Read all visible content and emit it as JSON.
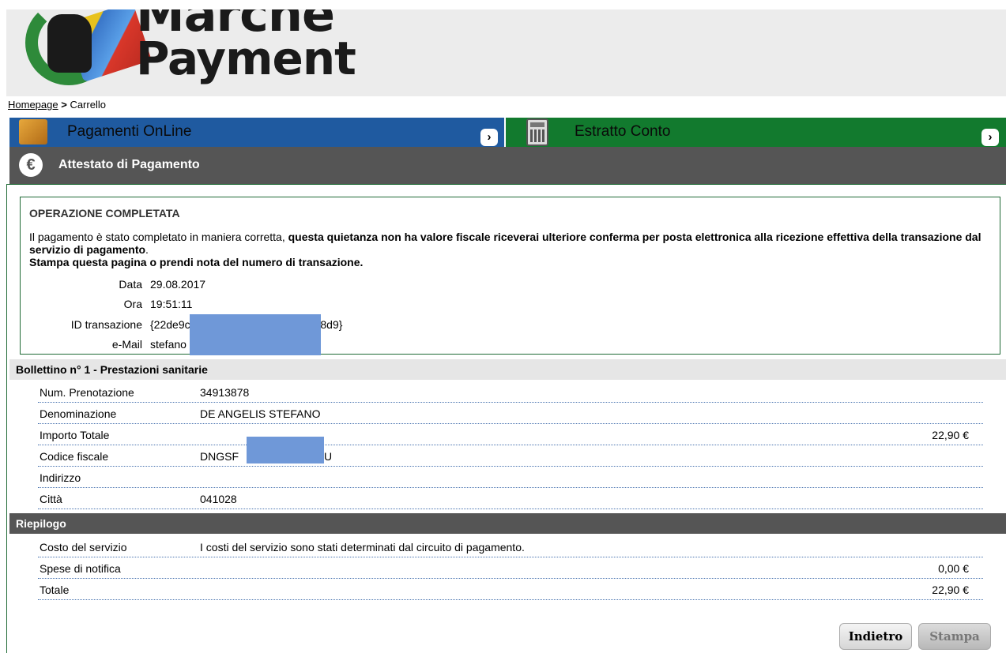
{
  "header": {
    "logo_line1": "Marche",
    "logo_line2": "Payment"
  },
  "breadcrumb": {
    "home": "Homepage",
    "separator": " > ",
    "current": "Carrello"
  },
  "nav": {
    "online_label": "Pagamenti OnLine",
    "statement_label": "Estratto Conto",
    "arrow": "›",
    "colors": {
      "online": "#1f5aa0",
      "statement": "#127a2e"
    }
  },
  "section": {
    "title": "Attestato di Pagamento",
    "icon": "euro-icon"
  },
  "success": {
    "heading": "OPERAZIONE COMPLETATA",
    "msg_plain": "Il pagamento è stato completato in maniera corretta, ",
    "msg_bold": "questa quietanza non ha valore fiscale riceverai ulteriore conferma per posta elettronica alla ricezione effettiva della transazione dal servizio di pagamento",
    "msg_end": ".",
    "msg_line2": "Stampa questa pagina o prendi nota del numero di transazione.",
    "fields": [
      {
        "label": "Data",
        "value": "29.08.2017"
      },
      {
        "label": "Ora",
        "value": "19:51:11"
      },
      {
        "label": "ID transazione",
        "value": "{22de9c",
        "value_tail": "ae306f988d9}"
      },
      {
        "label": "e-Mail",
        "value": "stefano"
      }
    ]
  },
  "bollettino": {
    "title": "Bollettino n° 1 - Prestazioni sanitarie",
    "rows": [
      {
        "label": "Num. Prenotazione",
        "value": "34913878",
        "amount": ""
      },
      {
        "label": "Denominazione",
        "value": "DE ANGELIS STEFANO",
        "amount": ""
      },
      {
        "label": "Importo Totale",
        "value": "",
        "amount": "22,90 €"
      },
      {
        "label": "Codice fiscale",
        "value": "DNGSF",
        "value_tail": "U",
        "amount": ""
      },
      {
        "label": "Indirizzo",
        "value": "",
        "amount": ""
      },
      {
        "label": "Città",
        "value": "041028",
        "amount": ""
      }
    ]
  },
  "riepilogo": {
    "title": "Riepilogo",
    "rows": [
      {
        "label": "Costo del servizio",
        "value": "I costi del servizio sono stati determinati dal circuito di pagamento.",
        "amount": ""
      },
      {
        "label": "Spese di notifica",
        "value": "",
        "amount": "0,00 €"
      },
      {
        "label": "Totale",
        "value": "",
        "amount": "22,90 €"
      }
    ]
  },
  "buttons": {
    "back": "Indietro",
    "print": "Stampa"
  }
}
